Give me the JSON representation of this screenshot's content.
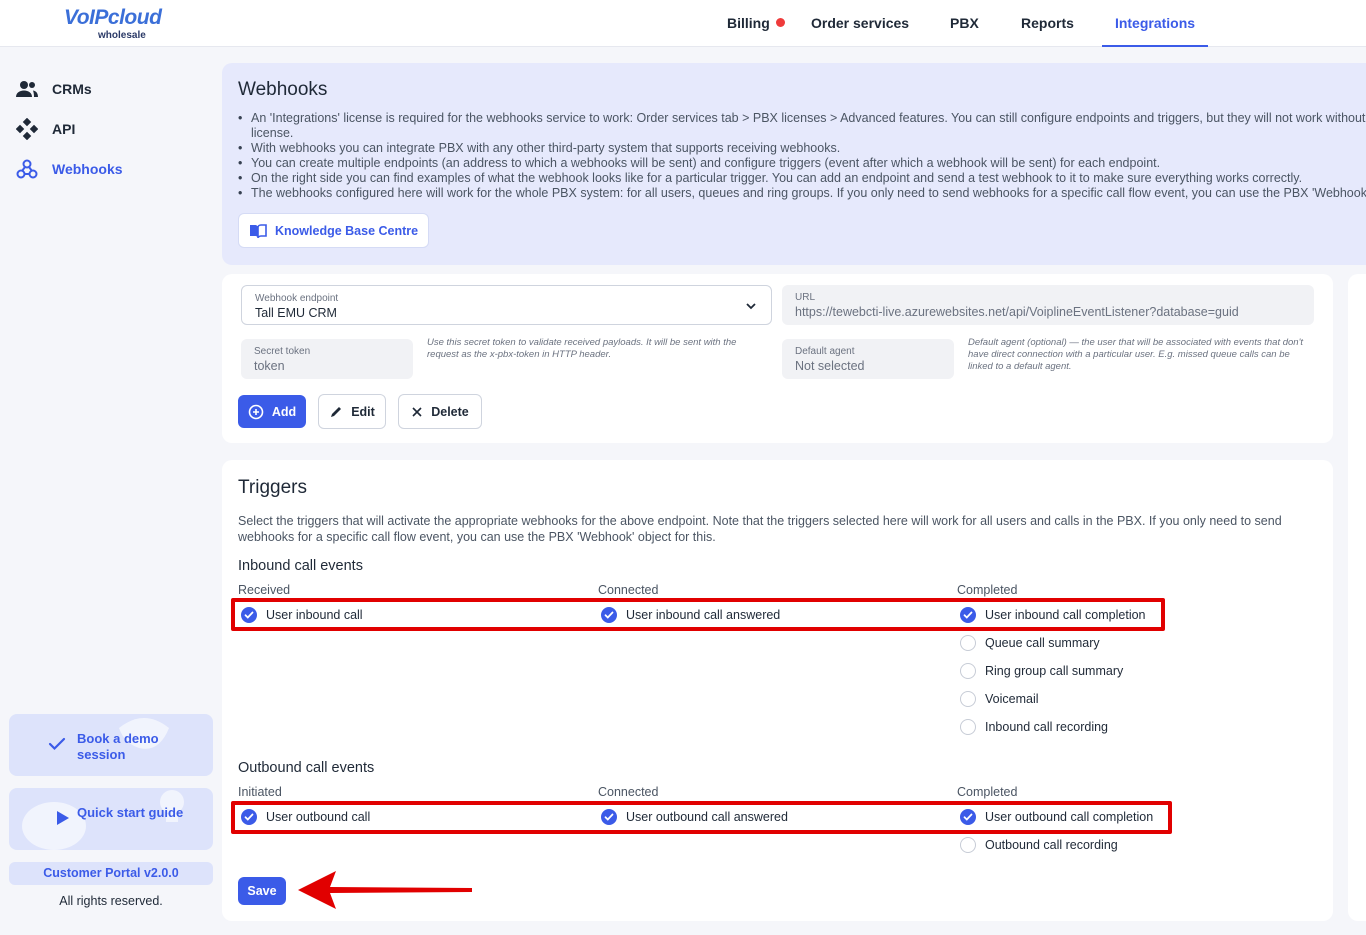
{
  "logo": {
    "brand": "VoIPcloud",
    "sub": "wholesale"
  },
  "topnav": {
    "billing": "Billing",
    "order_services": "Order services",
    "pbx": "PBX",
    "reports": "Reports",
    "integrations": "Integrations"
  },
  "sidebar": {
    "items": [
      {
        "label": "CRMs",
        "icon": "users-icon"
      },
      {
        "label": "API",
        "icon": "api-icon"
      },
      {
        "label": "Webhooks",
        "icon": "webhook-icon"
      }
    ],
    "book_demo": "Book a demo session",
    "quick_start": "Quick start guide",
    "portal_version": "Customer Portal v2.0.0",
    "rights": "All rights reserved."
  },
  "info": {
    "title": "Webhooks",
    "bullets": [
      "An 'Integrations' license is required for the webhooks service to work: Order services tab > PBX licenses > Advanced features. You can still configure endpoints and triggers, but they will not work without a license.",
      "With webhooks you can integrate PBX with any other third-party system that supports receiving webhooks.",
      "You can create multiple endpoints (an address to which a webhooks will be sent) and configure triggers (event after which a webhook will be sent) for each endpoint.",
      "On the right side you can find examples of what the webhook looks like for a particular trigger. You can add an endpoint and send a test webhook to it to make sure everything works correctly.",
      "The webhooks configured here will work for the whole PBX system: for all users, queues and ring groups. If you only need to send webhooks for a specific call flow event, you can use the PBX 'Webhook' object."
    ],
    "kb_button": "Knowledge Base Centre"
  },
  "endpoint": {
    "endpoint_label": "Webhook endpoint",
    "endpoint_value": "Tall EMU CRM",
    "url_label": "URL",
    "url_value": "https://tewebcti-live.azurewebsites.net/api/VoiplineEventListener?database=guid",
    "token_label": "Secret token",
    "token_value": "token",
    "token_hint": "Use this secret token to validate received payloads. It will be sent with the request as the x-pbx-token in HTTP header.",
    "agent_label": "Default agent",
    "agent_value": "Not selected",
    "agent_hint": "Default agent (optional) — the user that will be associated with events that don't have direct connection with a particular user. E.g. missed queue calls can be linked to a default agent.",
    "add": "Add",
    "edit": "Edit",
    "delete": "Delete"
  },
  "triggers": {
    "title": "Triggers",
    "description": "Select the triggers that will activate the appropriate webhooks for the above endpoint. Note that the triggers selected here will work for all users and calls in the PBX. If you only need to send webhooks for a specific call flow event, you can use the PBX 'Webhook' object for this.",
    "inbound": {
      "title": "Inbound call events",
      "col1": "Received",
      "col2": "Connected",
      "col3": "Completed",
      "user_inbound_call": "User inbound call",
      "user_inbound_call_answered": "User inbound call answered",
      "user_inbound_call_completion": "User inbound call completion",
      "queue_call_summary": "Queue call summary",
      "ring_group_call_summary": "Ring group call summary",
      "voicemail": "Voicemail",
      "inbound_call_recording": "Inbound call recording"
    },
    "outbound": {
      "title": "Outbound call events",
      "col1": "Initiated",
      "col2": "Connected",
      "col3": "Completed",
      "user_outbound_call": "User outbound call",
      "user_outbound_call_answered": "User outbound call answered",
      "user_outbound_call_completion": "User outbound call completion",
      "outbound_call_recording": "Outbound call recording"
    },
    "checked": {
      "user_inbound_call": true,
      "user_inbound_call_answered": true,
      "user_inbound_call_completion": true,
      "queue_call_summary": false,
      "ring_group_call_summary": false,
      "voicemail": false,
      "inbound_call_recording": false,
      "user_outbound_call": true,
      "user_outbound_call_answered": true,
      "user_outbound_call_completion": true,
      "outbound_call_recording": false
    },
    "save": "Save"
  },
  "colors": {
    "accent": "#3b5be8",
    "highlight": "#e10000",
    "alert_dot": "#ef3b3b"
  }
}
